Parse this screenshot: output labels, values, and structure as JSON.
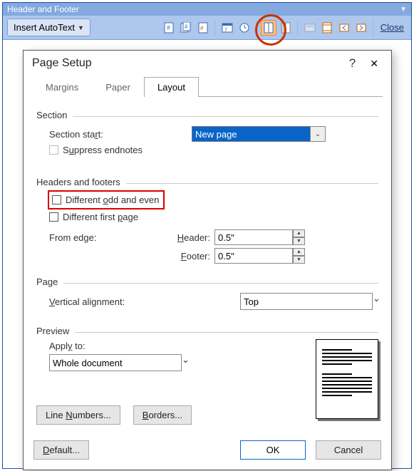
{
  "toolbar": {
    "title": "Header and Footer",
    "autotext": "Insert AutoText",
    "close": "Close",
    "icons": [
      "page-num",
      "pages-count",
      "format-num",
      "date",
      "time",
      "page-setup",
      "show-hide",
      "same-as-prev",
      "switch",
      "prev",
      "next",
      "link"
    ]
  },
  "dialog": {
    "title": "Page Setup",
    "tabs": {
      "margins": "Margins",
      "paper": "Paper",
      "layout": "Layout"
    },
    "section": {
      "label": "Section",
      "start_label_pre": "Section sta",
      "start_label_ul": "r",
      "start_label_post": "t:",
      "start_value": "New page",
      "suppress_pre": "S",
      "suppress_ul": "u",
      "suppress_post": "ppress endnotes"
    },
    "hf": {
      "label": "Headers and footers",
      "odd_even_pre": "Different ",
      "odd_even_ul": "o",
      "odd_even_post": "dd and even",
      "first_pre": "Different first ",
      "first_ul": "p",
      "first_post": "age",
      "from_edge": "From edge:",
      "header_lbl_ul": "H",
      "header_lbl_post": "eader:",
      "header_val": "0.5\"",
      "footer_lbl_ul": "F",
      "footer_lbl_post": "ooter:",
      "footer_val": "0.5\""
    },
    "page": {
      "label": "Page",
      "valign_ul": "V",
      "valign_post": "ertical alignment:",
      "valign_val": "Top"
    },
    "preview": {
      "label": "Preview",
      "apply_pre": "Appl",
      "apply_ul": "y",
      "apply_post": " to:",
      "apply_val": "Whole document"
    },
    "buttons": {
      "line_numbers_pre": "Line ",
      "line_numbers_ul": "N",
      "line_numbers_post": "umbers...",
      "borders_ul": "B",
      "borders_post": "orders...",
      "default_ul": "D",
      "default_post": "efault...",
      "ok": "OK",
      "cancel": "Cancel"
    }
  }
}
